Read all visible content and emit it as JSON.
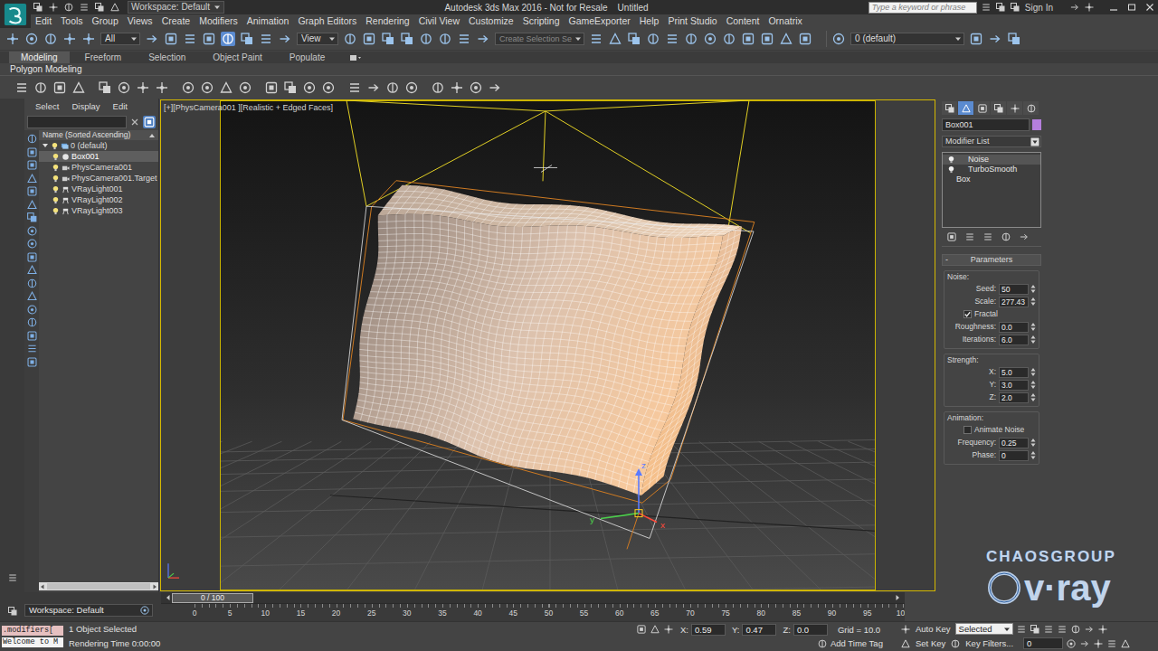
{
  "window": {
    "title": "Autodesk 3ds Max 2016 - Not for Resale    Untitled",
    "workspace": "Workspace: Default",
    "search_placeholder": "Type a keyword or phrase",
    "sign_in": "Sign In"
  },
  "menu": [
    "Edit",
    "Tools",
    "Group",
    "Views",
    "Create",
    "Modifiers",
    "Animation",
    "Graph Editors",
    "Rendering",
    "Civil View",
    "Customize",
    "Scripting",
    "GameExporter",
    "Help",
    "Print Studio",
    "Content",
    "Ornatrix"
  ],
  "main_toolbar": {
    "selection_filter": "All",
    "reference_coordinates": "View",
    "named_selection": "Create Selection Se",
    "layer": "0 (default)",
    "move_active": true
  },
  "ribbon": {
    "tabs": [
      {
        "label": "Modeling",
        "selected": true
      },
      {
        "label": "Freeform",
        "selected": false
      },
      {
        "label": "Selection",
        "selected": false
      },
      {
        "label": "Object Paint",
        "selected": false
      },
      {
        "label": "Populate",
        "selected": false
      }
    ],
    "panel": "Polygon Modeling"
  },
  "scene_explorer": {
    "tabs": [
      "Select",
      "Display",
      "Edit"
    ],
    "column": "Name (Sorted Ascending)",
    "items": [
      {
        "name": "0 (default)",
        "kind": "layer",
        "expanded": true,
        "selected": false
      },
      {
        "name": "Box001",
        "kind": "geometry",
        "selected": true
      },
      {
        "name": "PhysCamera001",
        "kind": "camera",
        "selected": false
      },
      {
        "name": "PhysCamera001.Target",
        "kind": "camera",
        "selected": false
      },
      {
        "name": "VRayLight001",
        "kind": "light",
        "selected": false
      },
      {
        "name": "VRayLight002",
        "kind": "light",
        "selected": false
      },
      {
        "name": "VRayLight003",
        "kind": "light",
        "selected": false
      }
    ]
  },
  "viewport": {
    "labels": [
      "[+]",
      "[PhysCamera001 ]",
      "[Realistic + Edged Faces]"
    ],
    "active": true,
    "gizmo_labels": [
      "z",
      "y",
      "x"
    ]
  },
  "command_panel": {
    "tabs": [
      {
        "selected": false
      },
      {
        "selected": true
      },
      {
        "selected": false
      },
      {
        "selected": false
      },
      {
        "selected": false
      },
      {
        "selected": false
      }
    ],
    "object_name": "Box001",
    "object_color": "#b57fdc",
    "modifier_list": "Modifier List",
    "stack": [
      {
        "name": "Noise",
        "kind": "modifier",
        "on": true,
        "selected": true
      },
      {
        "name": "TurboSmooth",
        "kind": "modifier",
        "on": true,
        "selected": false
      },
      {
        "name": "Box",
        "kind": "base",
        "selected": false
      }
    ],
    "rollout": {
      "title": "Parameters",
      "collapse": "-",
      "groups": [
        {
          "title": "Noise:",
          "rows": [
            {
              "kind": "spinner",
              "label": "Seed:",
              "value": "50"
            },
            {
              "kind": "spinner",
              "label": "Scale:",
              "value": "277.43"
            },
            {
              "kind": "checkbox",
              "label": "Fractal",
              "checked": true
            },
            {
              "kind": "spinner",
              "label": "Roughness:",
              "value": "0.0"
            },
            {
              "kind": "spinner",
              "label": "Iterations:",
              "value": "6.0"
            }
          ]
        },
        {
          "title": "Strength:",
          "rows": [
            {
              "kind": "spinner",
              "label": "X:",
              "value": "5.0"
            },
            {
              "kind": "spinner",
              "label": "Y:",
              "value": "3.0"
            },
            {
              "kind": "spinner",
              "label": "Z:",
              "value": "2.0"
            }
          ]
        },
        {
          "title": "Animation:",
          "rows": [
            {
              "kind": "checkbox",
              "label": "Animate Noise",
              "checked": false
            },
            {
              "kind": "spinner",
              "label": "Frequency:",
              "value": "0.25"
            },
            {
              "kind": "spinner",
              "label": "Phase:",
              "value": "0"
            }
          ]
        }
      ]
    }
  },
  "timeline": {
    "slider": "0 / 100",
    "level": 0,
    "ticks": [
      "0",
      "5",
      "10",
      "15",
      "20",
      "25",
      "30",
      "35",
      "40",
      "45",
      "50",
      "55",
      "60",
      "65",
      "70",
      "75",
      "80",
      "85",
      "90",
      "95",
      "100"
    ]
  },
  "status_bar": {
    "workspace": "Workspace: Default",
    "script_lines": [
      {
        "text": ".modifiers[",
        "kind": "input"
      },
      {
        "text": "Welcome to M",
        "kind": "output"
      }
    ],
    "selection": "1 Object Selected",
    "render_time": "Rendering Time 0:00:00",
    "coordinates": [
      {
        "label": "X:",
        "value": "0.59"
      },
      {
        "label": "Y:",
        "value": "0.47"
      },
      {
        "label": "Z:",
        "value": "0.0"
      }
    ],
    "grid": "Grid = 10.0",
    "time_tag": "Add Time Tag",
    "auto_key": "Auto Key",
    "key_mode": "Selected",
    "set_key": "Set Key",
    "key_filters": "Key Filters...",
    "frame": "0"
  },
  "logo": {
    "brand": "CHAOSGROUP",
    "product": "v·ray"
  }
}
